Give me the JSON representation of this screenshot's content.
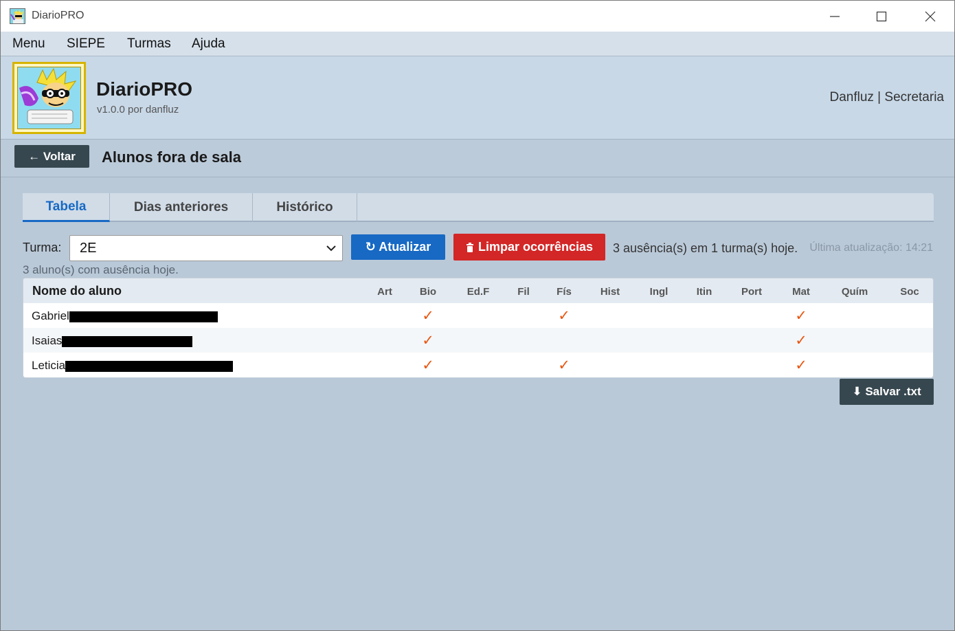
{
  "window": {
    "title": "DiarioPRO"
  },
  "menu": {
    "items": [
      "Menu",
      "SIEPE",
      "Turmas",
      "Ajuda"
    ]
  },
  "header": {
    "app_name": "DiarioPRO",
    "version": "v1.0.0 por danfluz",
    "user": "Danfluz | Secretaria"
  },
  "toolbar": {
    "back_label": "← Voltar",
    "page_title": "Alunos fora de sala"
  },
  "tabs": [
    {
      "label": "Tabela",
      "active": true
    },
    {
      "label": "Dias anteriores",
      "active": false
    },
    {
      "label": "Histórico",
      "active": false
    }
  ],
  "controls": {
    "turma_label": "Turma:",
    "turma_value": "2E",
    "refresh_label": "↻ Atualizar",
    "clear_label": "Limpar ocorrências",
    "summary": "3 ausência(s) em 1 turma(s) hoje.",
    "last_update": "Última atualização: 14:21",
    "count_info": "3 aluno(s) com ausência hoje."
  },
  "table": {
    "name_header": "Nome do aluno",
    "subjects": [
      "Art",
      "Bio",
      "Ed.F",
      "Fil",
      "Fís",
      "Hist",
      "Ingl",
      "Itin",
      "Port",
      "Mat",
      "Quím",
      "Soc"
    ],
    "check_mark": "✓",
    "rows": [
      {
        "name": "Gabriel",
        "absent": [
          "Bio",
          "Fís",
          "Mat"
        ]
      },
      {
        "name": "Isaias",
        "absent": [
          "Bio",
          "Mat"
        ]
      },
      {
        "name": "Leticia",
        "absent": [
          "Bio",
          "Fís",
          "Mat"
        ]
      }
    ]
  },
  "footer": {
    "save_label": "⬇ Salvar .txt"
  },
  "icons": {
    "app": "app-logo-icon",
    "minimize": "minimize-icon",
    "maximize": "maximize-icon",
    "close": "close-icon",
    "chevron": "chevron-down-icon",
    "trash": "trash-icon"
  },
  "colors": {
    "primary": "#1769c4",
    "danger": "#d32626",
    "dark": "#37474f",
    "check": "#e8560f",
    "background": "#bac9d8"
  }
}
